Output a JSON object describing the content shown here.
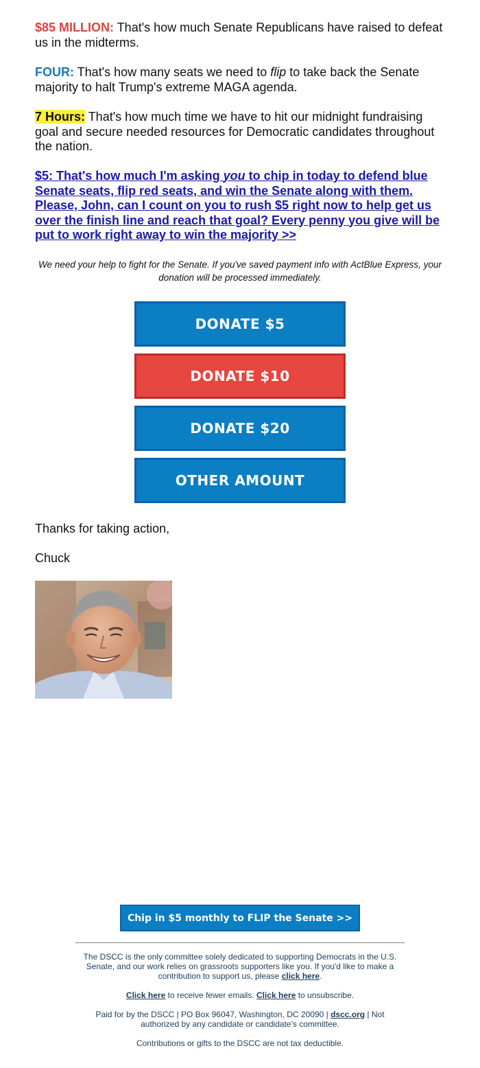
{
  "paragraphs": {
    "p1": {
      "lead": "$85 MILLION:",
      "text": " That's how much Senate Republicans have raised to defeat us in the midterms."
    },
    "p2": {
      "lead": "FOUR:",
      "text_before": " That's how many seats we need to ",
      "emphasis": "flip",
      "text_after": " to take back the Senate majority to halt Trump's extreme MAGA agenda."
    },
    "p3": {
      "lead": "7 Hours:",
      "text": " That's how much time we have to hit our midnight fundraising goal and secure needed resources for Democratic candidates throughout the nation."
    },
    "p4": {
      "text_before": "$5: That's how much I'm asking ",
      "emphasis": "you",
      "text_after": " to chip in today to defend blue Senate seats, flip red seats, and win the Senate along with them. Please, John, can I count on you to rush $5 right now to help get us over the finish line and reach that goal? Every penny you give will be put to work right away to win the majority >>"
    }
  },
  "note": "We need your help to fight for the Senate. If you've saved payment info with ActBlue Express, your donation will be processed immediately.",
  "buttons": {
    "donate5": "DONATE $5",
    "donate10": "DONATE $10",
    "donate20": "DONATE $20",
    "other": "OTHER AMOUNT"
  },
  "signoff": {
    "thanks": "Thanks for taking action,",
    "name": "Chuck"
  },
  "monthly_button": "Chip in $5 monthly to FLIP the Senate >>",
  "footer": {
    "about_text": "The DSCC is the only committee solely dedicated to supporting Democrats in the U.S. Senate, and our work relies on grassroots supporters like you. If you'd like to make a contribution to support us, please ",
    "about_link": "click here",
    "about_end": ".",
    "fewer_link": "Click here",
    "fewer_text": " to receive fewer emails. ",
    "unsub_link": "Click here",
    "unsub_text": " to unsubscribe.",
    "paid_text": "Paid for by the DSCC | PO Box 96047, Washington, DC 20090 | ",
    "site_link": "dscc.org",
    "paid_end": " | Not authorized by any candidate or candidate's committee.",
    "tax": "Contributions or gifts to the DSCC are not tax deductible."
  },
  "colors": {
    "red": "#d9463f",
    "blue": "#1a78b8",
    "button_blue": "#0b7ec4",
    "button_red": "#e64640",
    "highlight": "#ffef3a",
    "link": "#1a1aa8"
  }
}
